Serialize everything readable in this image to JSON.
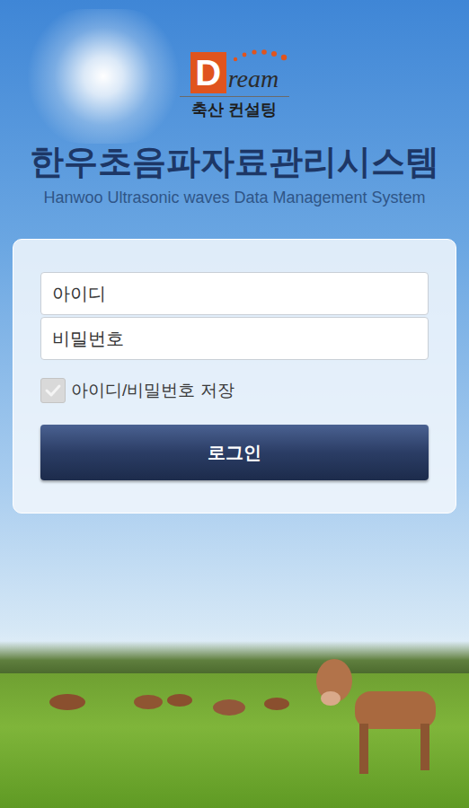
{
  "logo": {
    "letter": "D",
    "rest": "ream",
    "caption": "축산 컨설팅"
  },
  "title": "한우초음파자료관리시스템",
  "subtitle": "Hanwoo Ultrasonic waves Data Management System",
  "form": {
    "id_placeholder": "아이디",
    "password_placeholder": "비밀번호",
    "remember": {
      "label": "아이디/비밀번호 저장",
      "checked": true,
      "disabled": true
    },
    "login_button": "로그인"
  }
}
